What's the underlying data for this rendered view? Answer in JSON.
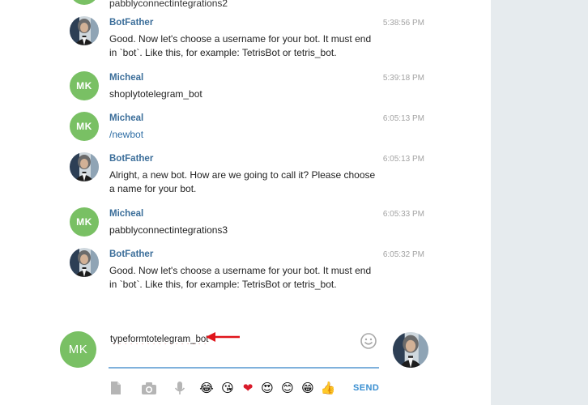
{
  "partial_message": {
    "text": "pabblyconnectintegrations2"
  },
  "messages": [
    {
      "author": "BotFather",
      "time": "5:38:56 PM",
      "text": "Good. Now let's choose a username for your bot. It must end in `bot`. Like this, for example: TetrisBot or tetris_bot.",
      "avatar": "bot-avatar"
    },
    {
      "author": "Micheal",
      "time": "5:39:18 PM",
      "text": "shoplytotelegram_bot",
      "avatar_initials": "MK"
    },
    {
      "author": "Micheal",
      "time": "6:05:13 PM",
      "text": "/newbot",
      "avatar_initials": "MK"
    },
    {
      "author": "BotFather",
      "time": "6:05:13 PM",
      "text": "Alright, a new bot. How are we going to call it? Please choose a name for your bot.",
      "avatar": "bot-avatar"
    },
    {
      "author": "Micheal",
      "time": "6:05:33 PM",
      "text": "pabblyconnectintegrations3",
      "avatar_initials": "MK"
    },
    {
      "author": "BotFather",
      "time": "6:05:32 PM",
      "text": "Good. Now let's choose a username for your bot. It must end in `bot`. Like this, for example: TetrisBot or tetris_bot.",
      "avatar": "bot-avatar"
    }
  ],
  "composer": {
    "me_initials": "MK",
    "input_value": "typeformtotelegram_bot",
    "send_label": "SEND",
    "quick_emojis": [
      "😂",
      "😘",
      "❤",
      "😍",
      "😊",
      "😁",
      "👍"
    ],
    "icons": [
      "document-icon",
      "camera-icon",
      "microphone-icon",
      "smile-icon"
    ]
  },
  "colors": {
    "avatar_green": "#79c064",
    "author_blue": "#3a6d99",
    "send_blue": "#3a8fd1",
    "arrow_red": "#e0151b"
  }
}
